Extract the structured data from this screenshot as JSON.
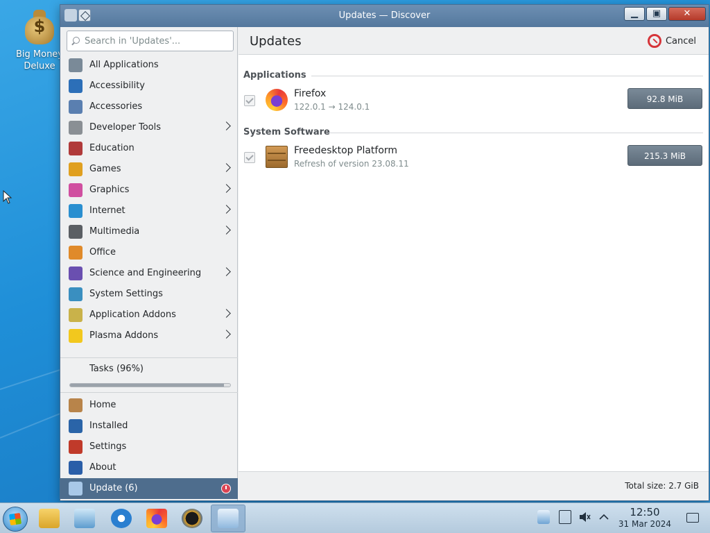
{
  "desktop": {
    "icon_label_1": "Big Money",
    "icon_label_2": "Deluxe"
  },
  "window": {
    "title": "Updates — Discover",
    "search_placeholder": "Search in 'Updates'...",
    "categories": [
      {
        "label": "All Applications",
        "icon": "all-apps-icon",
        "submenu": false,
        "color": "#7a8a98"
      },
      {
        "label": "Accessibility",
        "icon": "accessibility-icon",
        "submenu": false,
        "color": "#2c6fb8"
      },
      {
        "label": "Accessories",
        "icon": "accessories-icon",
        "submenu": false,
        "color": "#5a7fb0"
      },
      {
        "label": "Developer Tools",
        "icon": "developer-tools-icon",
        "submenu": true,
        "color": "#8a8f94"
      },
      {
        "label": "Education",
        "icon": "education-icon",
        "submenu": false,
        "color": "#b03a3a"
      },
      {
        "label": "Games",
        "icon": "games-icon",
        "submenu": true,
        "color": "#e0a020"
      },
      {
        "label": "Graphics",
        "icon": "graphics-icon",
        "submenu": true,
        "color": "#d04fa0"
      },
      {
        "label": "Internet",
        "icon": "internet-icon",
        "submenu": true,
        "color": "#2a8fd0"
      },
      {
        "label": "Multimedia",
        "icon": "multimedia-icon",
        "submenu": true,
        "color": "#5b5f64"
      },
      {
        "label": "Office",
        "icon": "office-icon",
        "submenu": false,
        "color": "#e08a2a"
      },
      {
        "label": "Science and Engineering",
        "icon": "science-icon",
        "submenu": true,
        "color": "#6a4fb0"
      },
      {
        "label": "System Settings",
        "icon": "system-settings-icon",
        "submenu": false,
        "color": "#3a8fc0"
      },
      {
        "label": "Application Addons",
        "icon": "application-addons-icon",
        "submenu": true,
        "color": "#c9b24a"
      },
      {
        "label": "Plasma Addons",
        "icon": "plasma-addons-icon",
        "submenu": true,
        "color": "#f2c81e"
      }
    ],
    "tasks": {
      "label": "Tasks (96%)",
      "progress": 0.96
    },
    "nav": [
      {
        "label": "Home",
        "icon": "home-icon",
        "color": "#b8844a"
      },
      {
        "label": "Installed",
        "icon": "installed-icon",
        "color": "#2a64a8"
      },
      {
        "label": "Settings",
        "icon": "settings-icon",
        "color": "#c03a2a"
      },
      {
        "label": "About",
        "icon": "about-icon",
        "color": "#2a5ea8"
      },
      {
        "label": "Update (6)",
        "icon": "update-icon",
        "color": "#a8c8e8",
        "active": true
      }
    ],
    "main": {
      "title": "Updates",
      "cancel_label": "Cancel",
      "sections": [
        {
          "heading": "Applications",
          "updates": [
            {
              "name": "Firefox",
              "detail": "122.0.1 → 124.0.1",
              "size": "92.8 MiB",
              "icon": "firefox-icon"
            }
          ]
        },
        {
          "heading": "System Software",
          "updates": [
            {
              "name": "Freedesktop Platform",
              "detail": "Refresh of version 23.08.11",
              "size": "215.3 MiB",
              "icon": "package-box-icon"
            }
          ]
        }
      ],
      "total_size": "Total size: 2.7 GiB"
    }
  },
  "taskbar": {
    "apps": [
      "file-manager-icon",
      "system-settings-icon",
      "internet-explorer-icon",
      "firefox-icon",
      "game-icon",
      "discover-icon"
    ],
    "time": "12:50",
    "date": "31 Mar 2024"
  }
}
